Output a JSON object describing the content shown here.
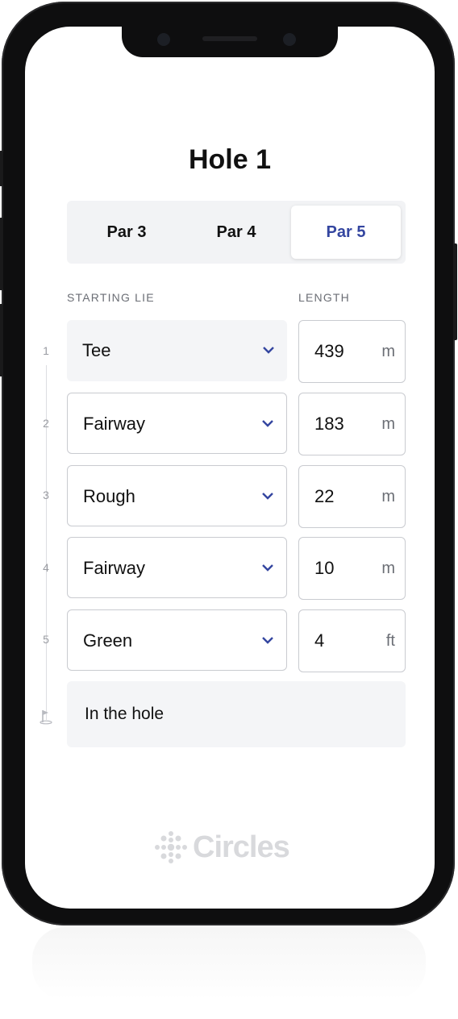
{
  "screen": {
    "title": "Hole 1",
    "par_options": [
      {
        "label": "Par 3",
        "selected": false
      },
      {
        "label": "Par 4",
        "selected": false
      },
      {
        "label": "Par 5",
        "selected": true
      }
    ],
    "columns": {
      "starting_lie": "STARTING LIE",
      "length": "LENGTH"
    },
    "shots": [
      {
        "num": "1",
        "lie": "Tee",
        "length": "439",
        "unit": "m"
      },
      {
        "num": "2",
        "lie": "Fairway",
        "length": "183",
        "unit": "m"
      },
      {
        "num": "3",
        "lie": "Rough",
        "length": "22",
        "unit": "m"
      },
      {
        "num": "4",
        "lie": "Fairway",
        "length": "10",
        "unit": "m"
      },
      {
        "num": "5",
        "lie": "Green",
        "length": "4",
        "unit": "ft"
      }
    ],
    "final": {
      "label": "In the hole",
      "icon": "flag-icon"
    }
  },
  "branding": {
    "logo_text": "Circles"
  },
  "colors": {
    "accent": "#3446a0",
    "muted": "#6b6e75",
    "field_bg": "#f4f5f7"
  }
}
